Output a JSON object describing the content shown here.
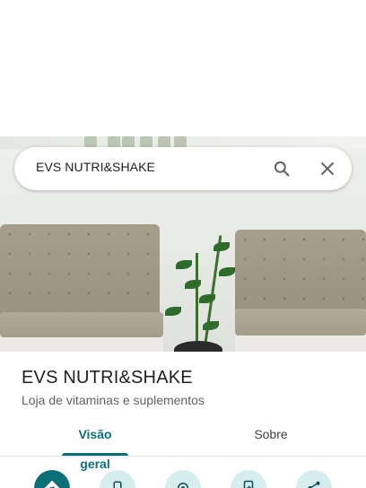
{
  "search": {
    "query": "EVS NUTRI&SHAKE",
    "search_icon": "search-icon",
    "clear_icon": "close-icon"
  },
  "place": {
    "name": "EVS NUTRI&SHAKE",
    "category": "Loja de vitaminas e suplementos"
  },
  "tabs": [
    {
      "label": "Visão geral",
      "active": true
    },
    {
      "label": "Sobre",
      "active": false
    }
  ],
  "actions": [
    {
      "icon": "directions-icon"
    },
    {
      "icon": "phone-icon"
    },
    {
      "icon": "location-icon"
    },
    {
      "icon": "send-to-phone-icon"
    },
    {
      "icon": "share-icon"
    }
  ],
  "colors": {
    "accent": "#0b6f78",
    "action_secondary_bg": "#d6eef0"
  }
}
